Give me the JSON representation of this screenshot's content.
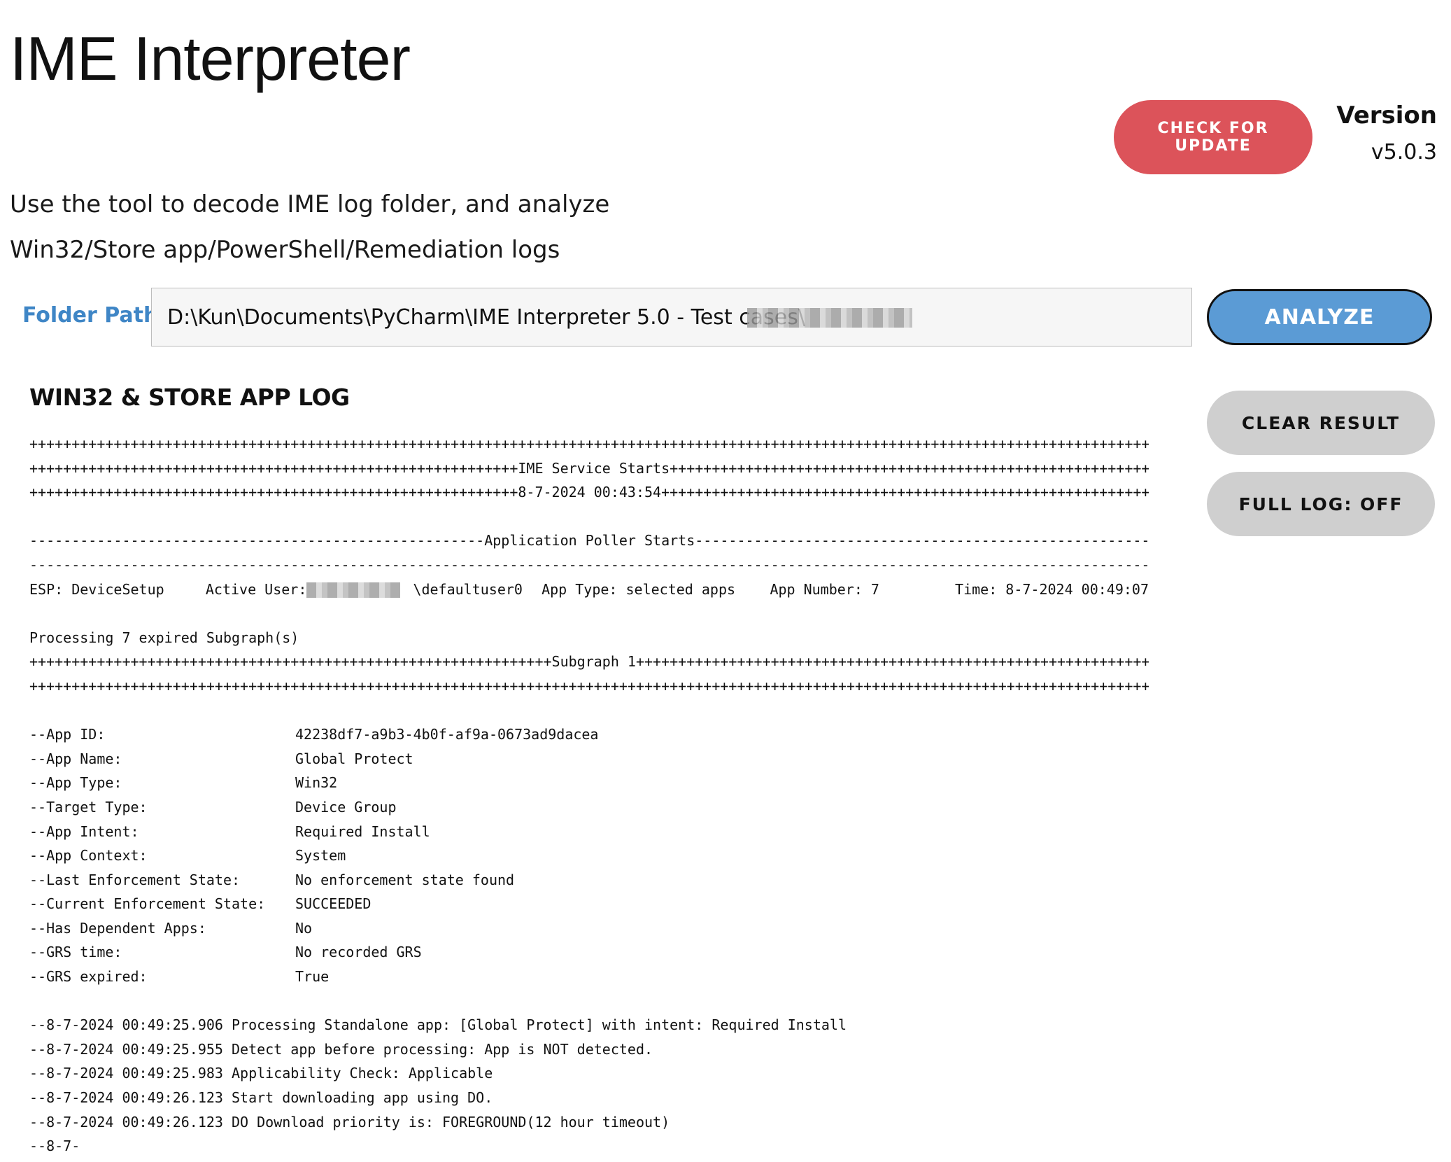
{
  "app": {
    "title": "IME Interpreter",
    "description_line1": "Use the tool to decode IME log folder, and analyze",
    "description_line2": "Win32/Store app/PowerShell/Remediation logs"
  },
  "header": {
    "check_update_label": "CHECK FOR UPDATE",
    "version_label": "Version",
    "version_value": "v5.0.3"
  },
  "folder": {
    "label": "Folder Path",
    "value": "D:\\Kun\\Documents\\PyCharm\\IME Interpreter 5.0 - Test cases\\"
  },
  "buttons": {
    "analyze": "ANALYZE",
    "clear_result": "CLEAR RESULT",
    "full_log": "FULL LOG: OFF"
  },
  "colors": {
    "update_button": "#dc535a",
    "analyze_button": "#5b9bd5",
    "folder_label": "#3f86c6",
    "gray_button": "#cfcfcf"
  },
  "log": {
    "heading": "WIN32 & STORE APP LOG",
    "banner": [
      "++++++++++++++++++++++++++++++++++++++++++++++++++++++++++++++++++++++++++++++++++++++++++++++++++++++++++++++++++++++++++++++++++++++",
      "++++++++++++++++++++++++++++++++++++++++++++++++++++++++++IME Service Starts++++++++++++++++++++++++++++++++++++++++++++++++++++++++++",
      "++++++++++++++++++++++++++++++++++++++++++++++++++++++++++8-7-2024 00:43:54+++++++++++++++++++++++++++++++++++++++++++++++++++++++++++"
    ],
    "poller": [
      "------------------------------------------------------Application Poller Starts------------------------------------------------------",
      "-----------------------------------------------------------------------------------------------------------------------------------------"
    ],
    "esp": {
      "esp": "ESP: DeviceSetup",
      "active_user_prefix": "Active User: ",
      "active_user_suffix": "\\defaultuser0",
      "app_type": "App Type: selected apps",
      "app_number": "App Number: 7",
      "time": "Time: 8-7-2024 00:49:07"
    },
    "processing": "Processing 7 expired Subgraph(s)",
    "subgraph": [
      "++++++++++++++++++++++++++++++++++++++++++++++++++++++++++++++Subgraph 1+++++++++++++++++++++++++++++++++++++++++++++++++++++++++++++",
      "++++++++++++++++++++++++++++++++++++++++++++++++++++++++++++++++++++++++++++++++++++++++++++++++++++++++++++++++++++++++++++++++++++++"
    ],
    "app_details": [
      {
        "key": "--App ID:",
        "value": "42238df7-a9b3-4b0f-af9a-0673ad9dacea"
      },
      {
        "key": "--App Name:",
        "value": "Global Protect"
      },
      {
        "key": "--App Type:",
        "value": "Win32"
      },
      {
        "key": "--Target Type:",
        "value": "Device Group"
      },
      {
        "key": "--App Intent:",
        "value": "Required Install"
      },
      {
        "key": "--App Context:",
        "value": "System"
      },
      {
        "key": "--Last Enforcement State:",
        "value": "No enforcement state found"
      },
      {
        "key": "--Current Enforcement State:",
        "value": "SUCCEEDED"
      },
      {
        "key": "--Has Dependent Apps:",
        "value": "No"
      },
      {
        "key": "--GRS time:",
        "value": "No recorded GRS"
      },
      {
        "key": "--GRS expired:",
        "value": "True"
      }
    ],
    "events": [
      "--8-7-2024 00:49:25.906 Processing Standalone app: [Global Protect] with intent: Required Install",
      "--8-7-2024 00:49:25.955 Detect app before processing: App is NOT detected.",
      "--8-7-2024 00:49:25.983 Applicability Check: Applicable",
      "--8-7-2024 00:49:26.123 Start downloading app using DO.",
      "--8-7-2024 00:49:26.123 DO Download priority is: FOREGROUND(12 hour timeout)",
      "--8-7-"
    ]
  }
}
